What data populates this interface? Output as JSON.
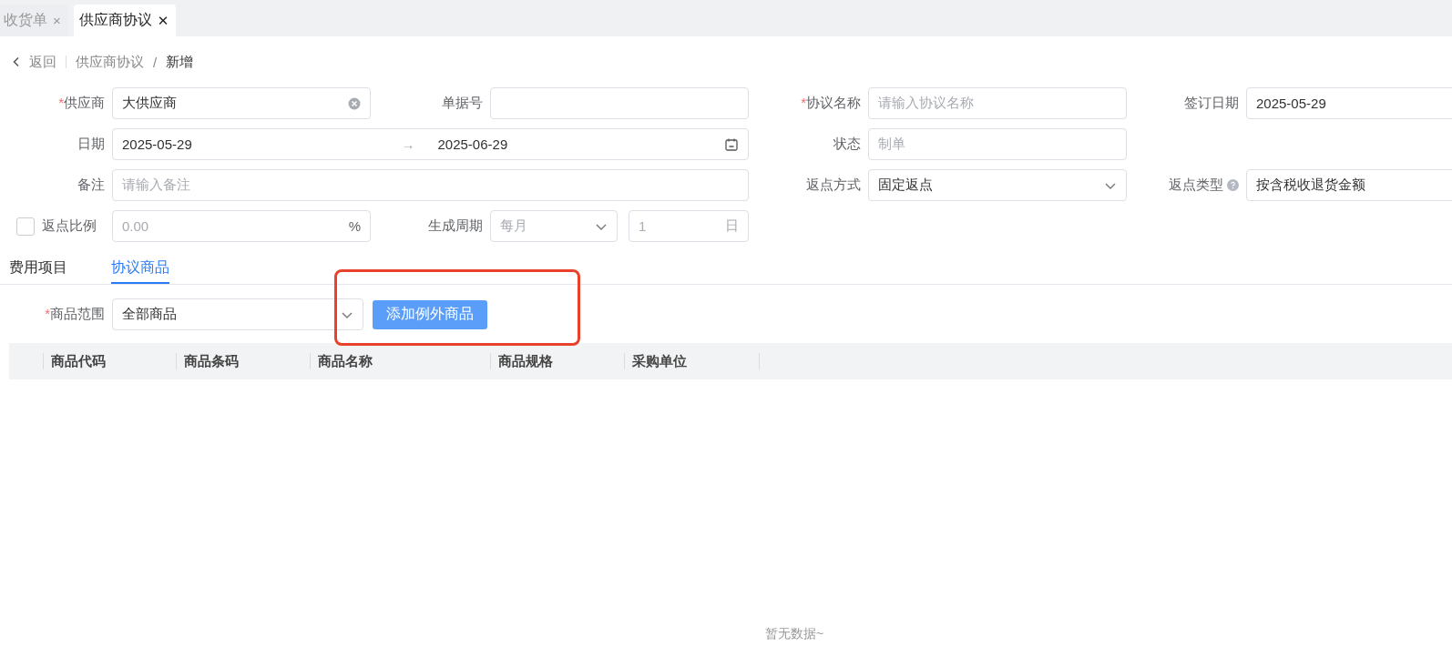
{
  "page_tabs": [
    {
      "label": "收货单",
      "close": "×",
      "selected": false
    },
    {
      "label": "供应商协议",
      "close": "✕",
      "selected": true
    }
  ],
  "breadcrumb": {
    "back": "返回",
    "separator": "/",
    "items": [
      "供应商协议",
      "新增"
    ]
  },
  "form_rows": [
    [
      {
        "label": "供应商",
        "required_mark": "*",
        "kind": "clearable",
        "value": "大供应商"
      },
      {
        "label": "单据号",
        "kind": "text"
      },
      {
        "label": "协议名称",
        "required_mark": "*",
        "kind": "text",
        "placeholder": "请输入协议名称"
      },
      {
        "label": "签订日期",
        "kind": "text",
        "value": "2025-05-29"
      }
    ],
    [
      {
        "label": "日期",
        "kind": "date_range",
        "start": "2025-05-29",
        "separator": "→",
        "end": "2025-06-29"
      },
      {
        "label": "状态",
        "kind": "text",
        "placeholder": "制单"
      }
    ],
    [
      {
        "label": "备注",
        "kind": "wide",
        "placeholder": "请输入备注"
      },
      {
        "label": "返点方式",
        "kind": "select",
        "value": "固定返点"
      },
      {
        "label": "返点类型",
        "help": true,
        "kind": "text",
        "value": "按含税收退货金额"
      }
    ],
    [
      {
        "label": "返点比例",
        "checked": false,
        "kind": "suffix",
        "placeholder": "0.00",
        "suffix": "%"
      },
      {
        "label": "生成周期",
        "kind": "period",
        "disabled": true,
        "select_value": "每月",
        "number": "1",
        "unit": "日"
      }
    ]
  ],
  "detail_tabs": [
    {
      "label": "费用项目",
      "selected": false
    },
    {
      "label": "协议商品",
      "selected": true
    }
  ],
  "goods_range": {
    "label": "商品范围",
    "required_mark": "*",
    "value": "全部商品",
    "button": "添加例外商品"
  },
  "table": {
    "columns": [
      "商品代码",
      "商品条码",
      "商品名称",
      "商品规格",
      "采购单位"
    ]
  },
  "empty_text": "暂无数据~"
}
